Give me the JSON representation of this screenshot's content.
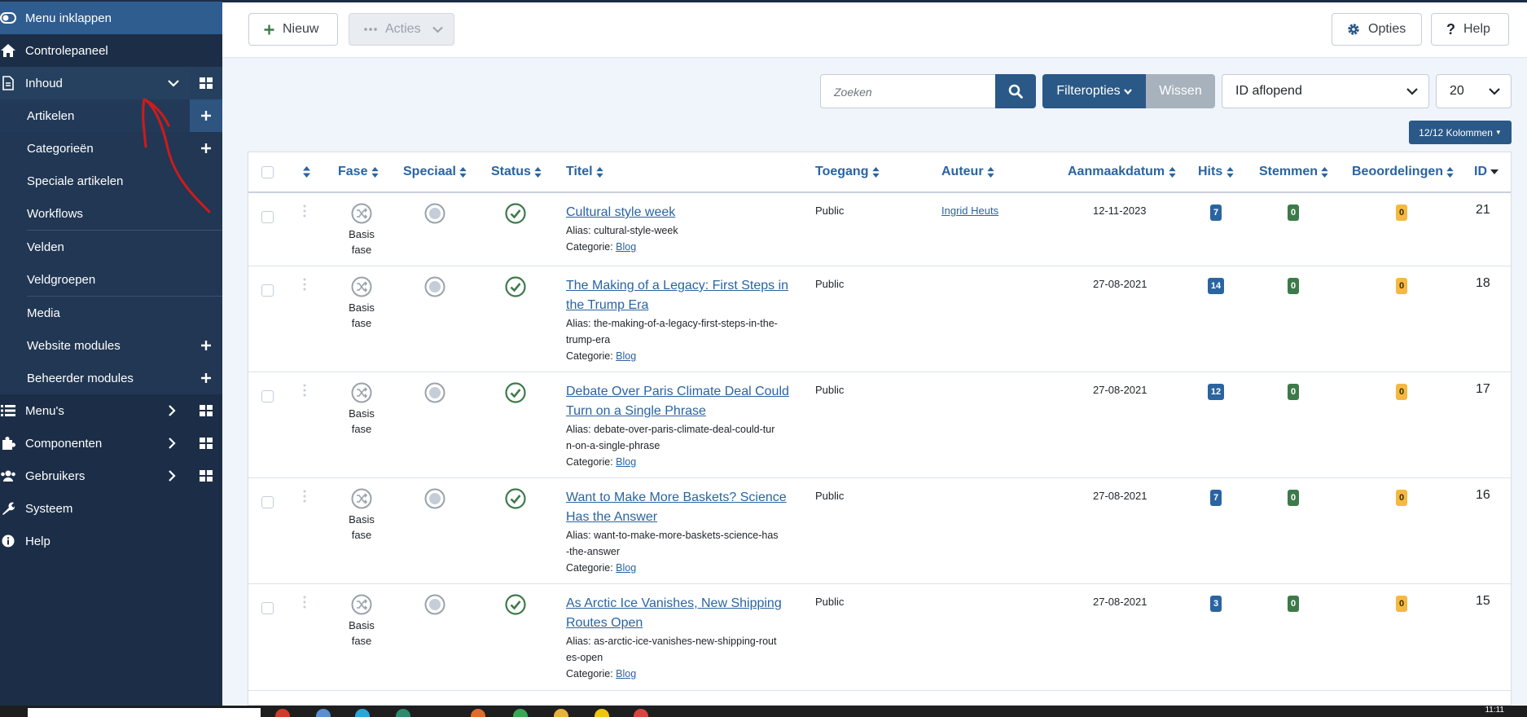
{
  "sidebar": {
    "collapse_label": "Menu inklappen",
    "items": [
      {
        "label": "Controlepaneel"
      },
      {
        "label": "Inhoud"
      },
      {
        "label": "Artikelen"
      },
      {
        "label": "Categorieën"
      },
      {
        "label": "Speciale artikelen"
      },
      {
        "label": "Workflows"
      },
      {
        "label": "Velden"
      },
      {
        "label": "Veldgroepen"
      },
      {
        "label": "Media"
      },
      {
        "label": "Website modules"
      },
      {
        "label": "Beheerder modules"
      },
      {
        "label": "Menu's"
      },
      {
        "label": "Componenten"
      },
      {
        "label": "Gebruikers"
      },
      {
        "label": "Systeem"
      },
      {
        "label": "Help"
      }
    ]
  },
  "toolbar": {
    "new_label": "Nieuw",
    "actions_label": "Acties",
    "options_label": "Opties",
    "help_label": "Help"
  },
  "filters": {
    "search_placeholder": "Zoeken",
    "filter_options_label": "Filteropties",
    "clear_label": "Wissen",
    "sort_value": "ID aflopend",
    "limit_value": "20",
    "columns_label": "12/12 Kolommen"
  },
  "table": {
    "headers": {
      "fase": "Fase",
      "special": "Speciaal",
      "status": "Status",
      "title": "Titel",
      "access": "Toegang",
      "author": "Auteur",
      "created": "Aanmaakdatum",
      "hits": "Hits",
      "votes": "Stemmen",
      "ratings": "Beoordelingen",
      "id": "ID"
    },
    "stage_label_line1": "Basis",
    "stage_label_line2": "fase",
    "alias_prefix": "Alias:",
    "category_prefix": "Categorie:",
    "rows": [
      {
        "title": "Cultural style week",
        "alias_line1": "cultural-style-week",
        "alias_line2": "",
        "category": "Blog",
        "access": "Public",
        "author": "Ingrid Heuts",
        "created": "12-11-2023",
        "hits": "7",
        "votes": "0",
        "ratings": "0",
        "id": "21"
      },
      {
        "title": "The Making of a Legacy: First Steps in",
        "title2": "the Trump Era",
        "alias_line1": "the-making-of-a-legacy-first-steps-in-the-",
        "alias_line2": "trump-era",
        "category": "Blog",
        "access": "Public",
        "author": "",
        "created": "27-08-2021",
        "hits": "14",
        "votes": "0",
        "ratings": "0",
        "id": "18"
      },
      {
        "title": "Debate Over Paris Climate Deal Could",
        "title2": "Turn on a Single Phrase",
        "alias_line1": "debate-over-paris-climate-deal-could-tur",
        "alias_line2": "n-on-a-single-phrase",
        "category": "Blog",
        "access": "Public",
        "author": "",
        "created": "27-08-2021",
        "hits": "12",
        "votes": "0",
        "ratings": "0",
        "id": "17"
      },
      {
        "title": "Want to Make More Baskets? Science",
        "title2": "Has the Answer",
        "alias_line1": "want-to-make-more-baskets-science-has",
        "alias_line2": "-the-answer",
        "category": "Blog",
        "access": "Public",
        "author": "",
        "created": "27-08-2021",
        "hits": "7",
        "votes": "0",
        "ratings": "0",
        "id": "16"
      },
      {
        "title": "As Arctic Ice Vanishes, New Shipping",
        "title2": "Routes Open",
        "alias_line1": "as-arctic-ice-vanishes-new-shipping-rout",
        "alias_line2": "es-open",
        "category": "Blog",
        "access": "Public",
        "author": "",
        "created": "27-08-2021",
        "hits": "3",
        "votes": "0",
        "ratings": "0",
        "id": "15"
      }
    ]
  },
  "taskbar": {
    "time": "11:11"
  },
  "colors": {
    "sidebar": "#1c2e47",
    "primary": "#2a5887",
    "link": "#2a64a1",
    "annotation": "#d11a1a"
  }
}
